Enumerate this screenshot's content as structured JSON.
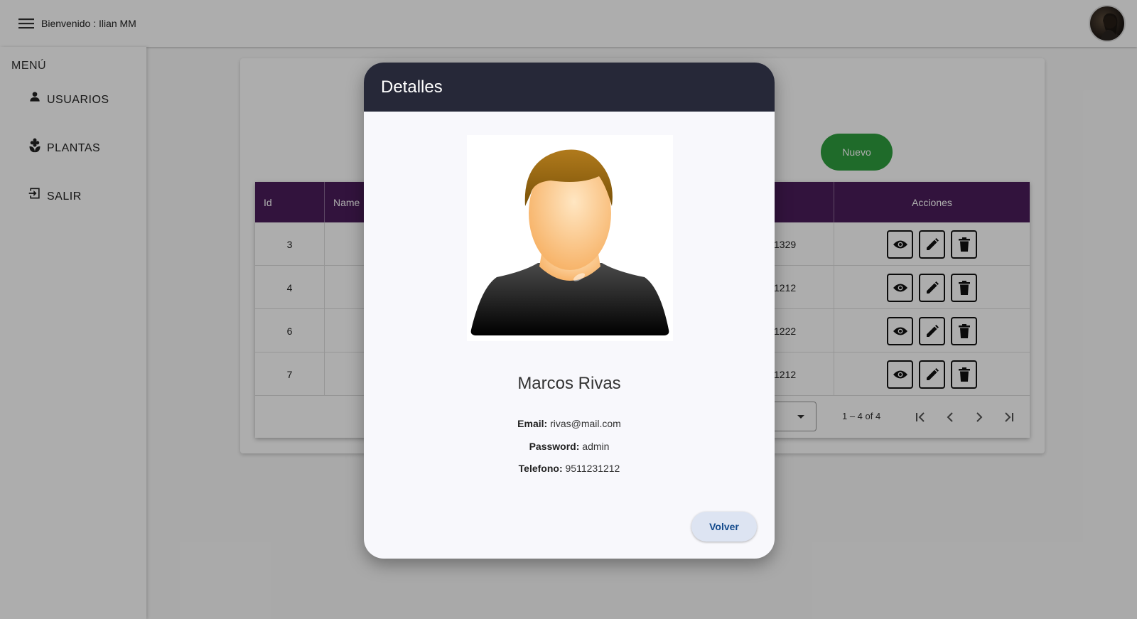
{
  "header": {
    "welcome_text": "Bienvenido : Ilian MM"
  },
  "sidebar": {
    "title": "MENÚ",
    "items": [
      {
        "label": "USUARIOS",
        "icon": "person-icon"
      },
      {
        "label": "PLANTAS",
        "icon": "plant-icon"
      },
      {
        "label": "SALIR",
        "icon": "logout-icon"
      }
    ]
  },
  "main": {
    "new_button": "Nuevo",
    "table": {
      "headers": [
        "Id",
        "Name",
        "Acciones"
      ],
      "rows": [
        {
          "id": "3",
          "telefono": "1329"
        },
        {
          "id": "4",
          "telefono": "1212"
        },
        {
          "id": "6",
          "telefono": "1222"
        },
        {
          "id": "7",
          "telefono": "1212"
        }
      ]
    },
    "paginator": {
      "range": "1 – 4 of 4"
    }
  },
  "dialog": {
    "title": "Detalles",
    "name": "Marcos Rivas",
    "email_label": "Email:",
    "email": "rivas@mail.com",
    "password_label": "Password:",
    "password": "admin",
    "telefono_label": "Telefono:",
    "telefono": "9511231212",
    "back_button": "Volver"
  },
  "colors": {
    "table_header": "#4a1d5a",
    "new_button": "#2e9e3e",
    "dialog_header": "#262838",
    "back_button_text": "#134a8c"
  }
}
